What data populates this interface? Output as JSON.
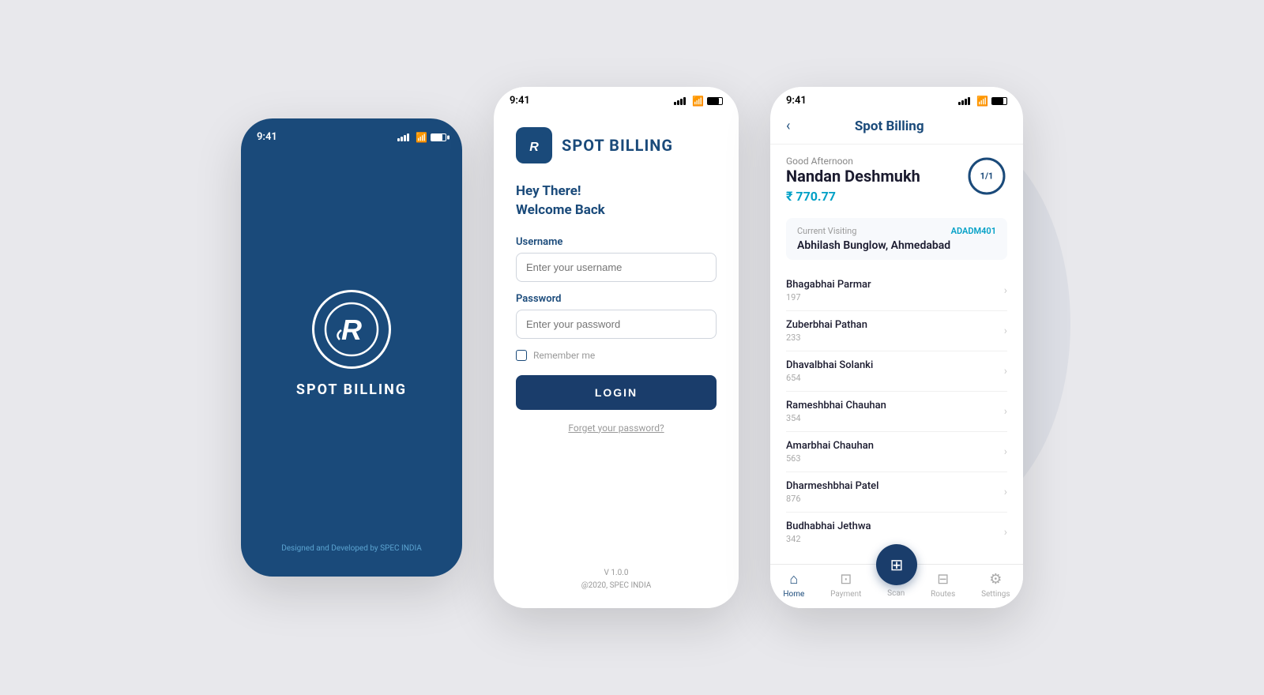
{
  "background": "#e8e8ec",
  "phone1": {
    "time": "9:41",
    "app_name": "SPOT BILLING",
    "footer": "Designed and Developed by SPEC INDIA"
  },
  "phone2": {
    "time": "9:41",
    "app_name": "SPOT BILLING",
    "greeting_line1": "Hey There!",
    "greeting_line2": "Welcome Back",
    "username_label": "Username",
    "username_placeholder": "Enter your username",
    "password_label": "Password",
    "password_placeholder": "Enter your password",
    "remember_label": "Remember me",
    "login_button": "LOGIN",
    "forgot_link": "Forget your password?",
    "version": "V 1.0.0",
    "copyright": "@2020, SPEC INDIA"
  },
  "phone3": {
    "time": "9:41",
    "title": "Spot Billing",
    "greeting": "Good Afternoon",
    "user_name": "Nandan Deshmukh",
    "amount": "₹ 770.77",
    "progress_label": "1/1",
    "current_visiting_label": "Current Visiting",
    "current_visiting_name": "Abhilash Bunglow, Ahmedabad",
    "current_visiting_code": "ADADM401",
    "customers": [
      {
        "name": "Bhagabhai Parmar",
        "num": "197"
      },
      {
        "name": "Zuberbhai Pathan",
        "num": "233"
      },
      {
        "name": "Dhavalbhai Solanki",
        "num": "654"
      },
      {
        "name": "Rameshbhai Chauhan",
        "num": "354"
      },
      {
        "name": "Amarbhai Chauhan",
        "num": "563"
      },
      {
        "name": "Dharmeshbhai Patel",
        "num": "876"
      },
      {
        "name": "Budhabhai Jethwa",
        "num": "342"
      }
    ],
    "nav": [
      {
        "label": "Home",
        "icon": "⌂",
        "active": true
      },
      {
        "label": "Payment",
        "icon": "⊡",
        "active": false
      },
      {
        "label": "Scan",
        "icon": "⊞",
        "active": false,
        "fab": true
      },
      {
        "label": "Routes",
        "icon": "⊟",
        "active": false
      },
      {
        "label": "Settings",
        "icon": "⚙",
        "active": false
      }
    ]
  }
}
